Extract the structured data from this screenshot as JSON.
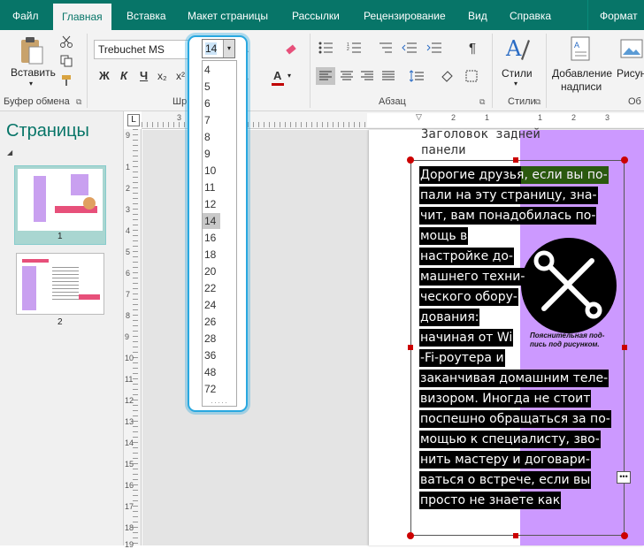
{
  "tabs": [
    "Файл",
    "Главная",
    "Вставка",
    "Макет страницы",
    "Рассылки",
    "Рецензирование",
    "Вид",
    "Справка",
    "Формат"
  ],
  "ribbon": {
    "paste_label": "Вставить",
    "clipboard_group": "Буфер обмена",
    "font_group": "Шрифт",
    "paragraph_group": "Абзац",
    "styles_label": "Стили",
    "styles_group": "Стили",
    "add_caption_label1": "Добавление",
    "add_caption_label2": "надписи",
    "picture_label": "Рисун",
    "objects_group": "Об",
    "font_name": "Trebuchet MS",
    "font_size": "14",
    "bold": "Ж",
    "italic": "К",
    "underline": "Ч",
    "subscript": "x₂",
    "superscript": "x²",
    "font_color": "A"
  },
  "font_sizes": [
    "4",
    "5",
    "6",
    "7",
    "8",
    "9",
    "10",
    "11",
    "12",
    "14",
    "16",
    "18",
    "20",
    "22",
    "24",
    "26",
    "28",
    "36",
    "48",
    "72"
  ],
  "font_size_selected": "14",
  "pages_panel": {
    "title": "Страницы",
    "page1": "1",
    "page2": "2"
  },
  "ruler": {
    "corner": "L",
    "v_numbers": [
      "9",
      "1",
      "2",
      "3",
      "4",
      "5",
      "6",
      "7",
      "8",
      "9",
      "10",
      "11",
      "12",
      "13",
      "14",
      "15",
      "16",
      "17",
      "18",
      "19"
    ],
    "h_numbers": [
      "3",
      "2",
      "1",
      "1",
      "2",
      "3"
    ]
  },
  "document": {
    "heading1": "Заголовок задней",
    "heading2": "панели",
    "lines": [
      "Дорогие друзья, если вы по-",
      "пали на эту страницу, зна-",
      "чит, вам понадобилась по-",
      "мощь в",
      "настройке до-",
      "машнего техни-",
      "ческого обору-",
      "дования:",
      "начиная от Wi",
      "-Fi-роутера и",
      "заканчивая домашним теле-",
      "визором. Иногда не стоит",
      "поспешно обращаться за по-",
      "мощью к специалисту, зво-",
      "нить мастеру и договари-",
      "ваться о встрече, если вы",
      "просто не знаете как"
    ],
    "caption1": "Пояснительная под-",
    "caption2": "пись под рисунком."
  },
  "colors": {
    "brand": "#077568",
    "purple": "#cc99ff",
    "green": "#2f6210",
    "dropdown_border": "#29a8e0"
  }
}
